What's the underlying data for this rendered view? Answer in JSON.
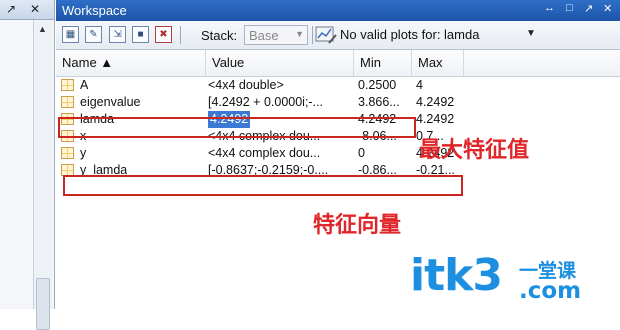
{
  "left_panel": {
    "pin_glyph": "↗",
    "close_glyph": "✕",
    "scroll_up_glyph": "▲"
  },
  "window": {
    "title": "Workspace",
    "controls": [
      "↔",
      "□",
      "↗",
      "✕"
    ]
  },
  "toolbar": {
    "stack_label": "Stack:",
    "stack_value": "Base",
    "plot_status": "No valid plots for: lamda",
    "icons": [
      "new-variable-icon",
      "open-file-icon",
      "import-data-icon",
      "save-icon",
      "delete-icon"
    ]
  },
  "table": {
    "columns": [
      {
        "label": "Name ▲"
      },
      {
        "label": "Value"
      },
      {
        "label": "Min"
      },
      {
        "label": "Max"
      }
    ],
    "rows": [
      {
        "name": "A",
        "value": "<4x4 double>",
        "min": "0.2500",
        "max": "4"
      },
      {
        "name": "eigenvalue",
        "value": "[4.2492 + 0.0000i;-...",
        "min": "3.866...",
        "max": "4.2492"
      },
      {
        "name": "lamda",
        "value": "4.2492",
        "min": "4.2492",
        "max": "4.2492",
        "selected": true
      },
      {
        "name": "x",
        "value": "<4x4 complex dou...",
        "min": "-8.06...",
        "max": "0.7..."
      },
      {
        "name": "y",
        "value": "<4x4 complex dou...",
        "min": "0",
        "max": "4.2492"
      },
      {
        "name": "y_lamda",
        "value": "[-0.8637;-0.2159;-0....",
        "min": "-0.86...",
        "max": "-0.21..."
      }
    ]
  },
  "annotations": {
    "max_eigenvalue": "最大特征值",
    "eigenvector": "特征向量"
  },
  "watermark": {
    "main": "itk3",
    "cn": "一堂课",
    "com": ".com"
  },
  "colors": {
    "title_bar": "#1c54a8",
    "selection": "#3c79d4",
    "annotation": "#e0262a",
    "watermark": "#1d8fe0"
  }
}
